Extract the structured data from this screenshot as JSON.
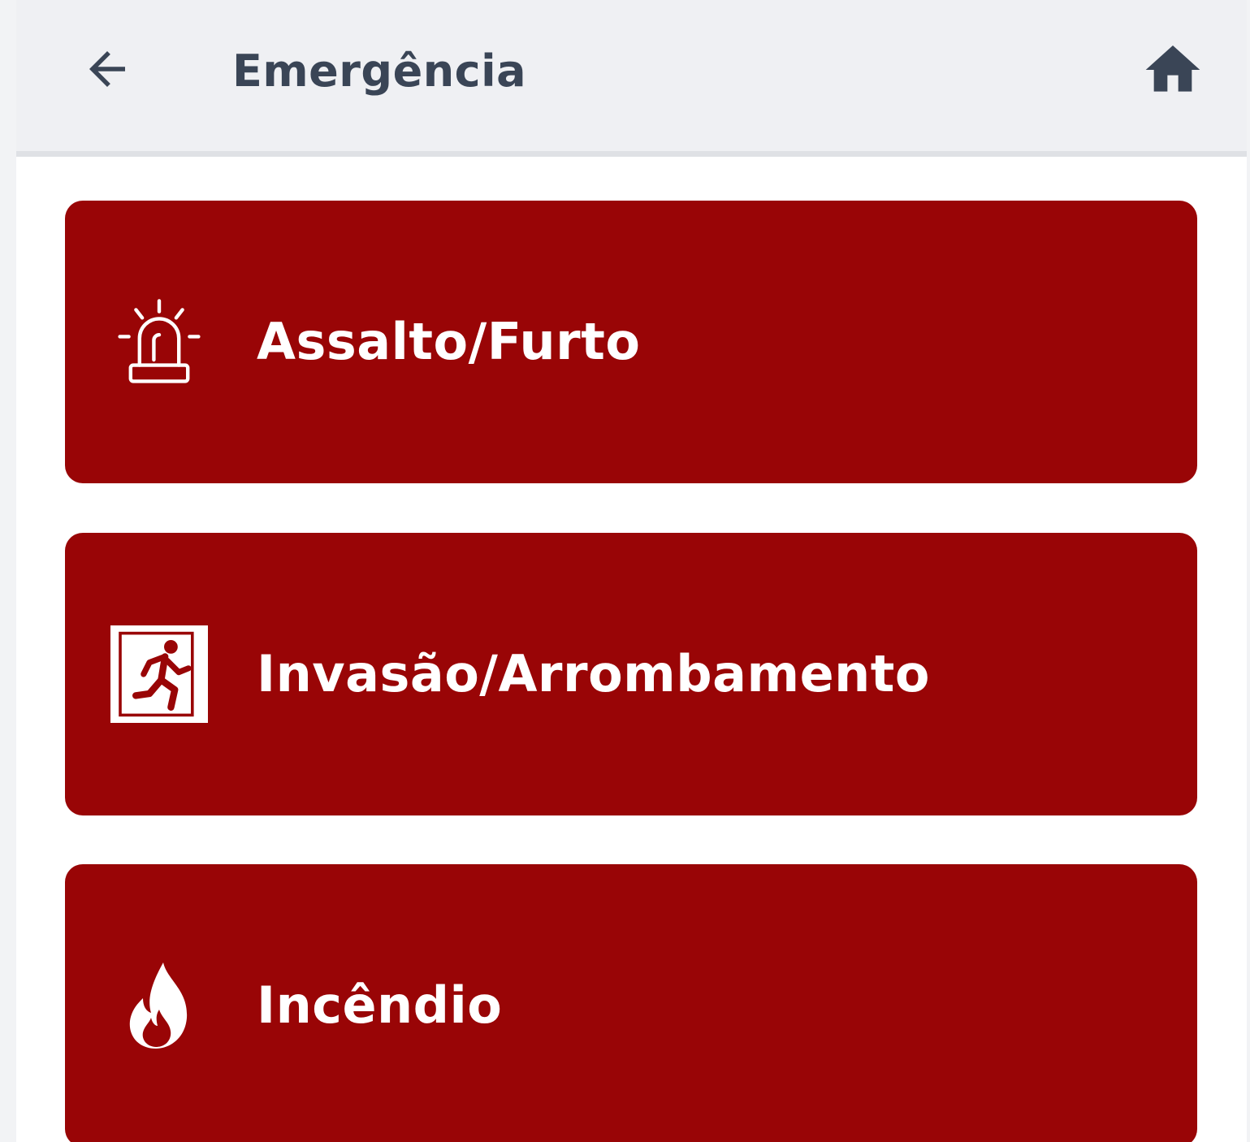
{
  "header": {
    "title": "Emergência",
    "back_icon": "arrow-left-icon",
    "home_icon": "home-icon"
  },
  "options": [
    {
      "label": "Assalto/Furto",
      "icon": "siren-icon"
    },
    {
      "label": "Invasão/Arrombamento",
      "icon": "exit-running-person-icon"
    },
    {
      "label": "Incêndio",
      "icon": "fire-icon"
    }
  ],
  "colors": {
    "card_background": "#990506",
    "header_text": "#3a4556",
    "header_background": "#eff0f3"
  }
}
